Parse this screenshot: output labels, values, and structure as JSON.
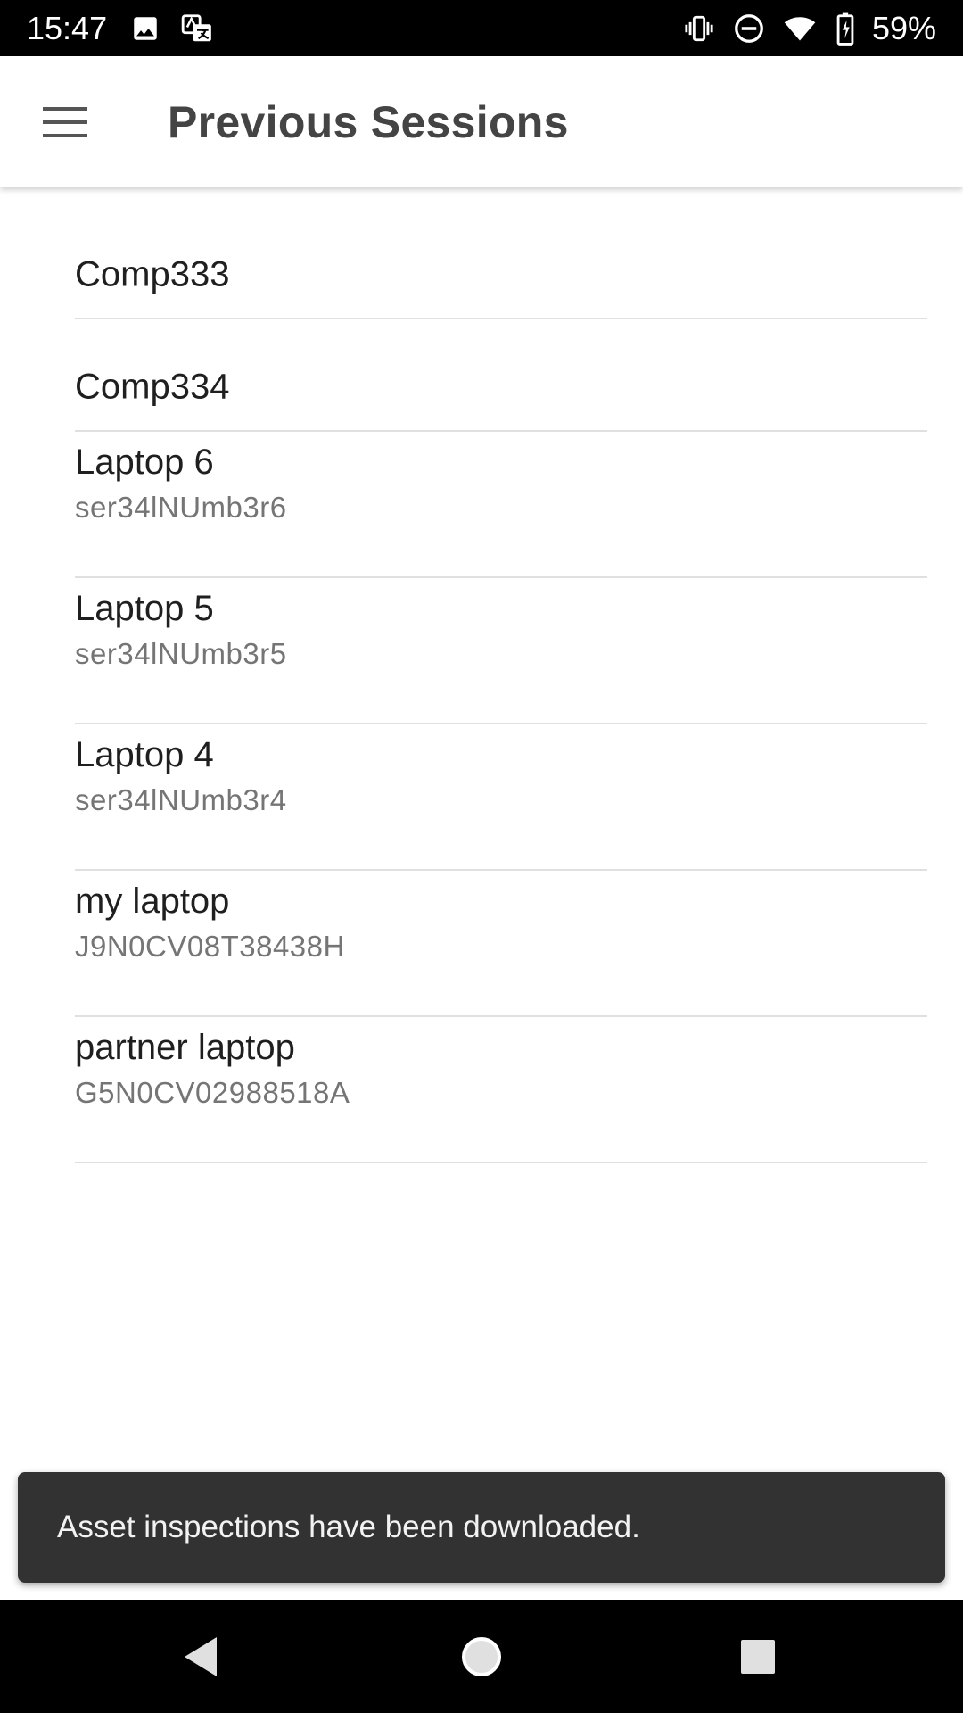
{
  "status_bar": {
    "time": "15:47",
    "battery_percent": "59%",
    "icons": [
      "image-icon",
      "translate-icon",
      "vibrate-icon",
      "do-not-disturb-icon",
      "wifi-icon",
      "battery-charging-icon"
    ]
  },
  "app_bar": {
    "title": "Previous Sessions",
    "menu_icon": "hamburger-menu-icon"
  },
  "sessions": [
    {
      "name": "Comp333"
    },
    {
      "name": "Comp334"
    },
    {
      "name": "Laptop 6",
      "serial": "ser34lNUmb3r6"
    },
    {
      "name": "Laptop 5",
      "serial": "ser34lNUmb3r5"
    },
    {
      "name": "Laptop 4",
      "serial": "ser34lNUmb3r4"
    },
    {
      "name": "my laptop",
      "serial": "J9N0CV08T38438H"
    },
    {
      "name": "partner laptop",
      "serial": "G5N0CV02988518A"
    }
  ],
  "snackbar": {
    "message": "Asset inspections have been downloaded."
  },
  "nav_bar": {
    "icons": [
      "back-icon",
      "home-icon",
      "recents-icon"
    ]
  },
  "colors": {
    "status_bar_bg": "#000000",
    "snackbar_bg": "#323232",
    "divider": "#e0e0e0",
    "title_text": "#444444"
  }
}
